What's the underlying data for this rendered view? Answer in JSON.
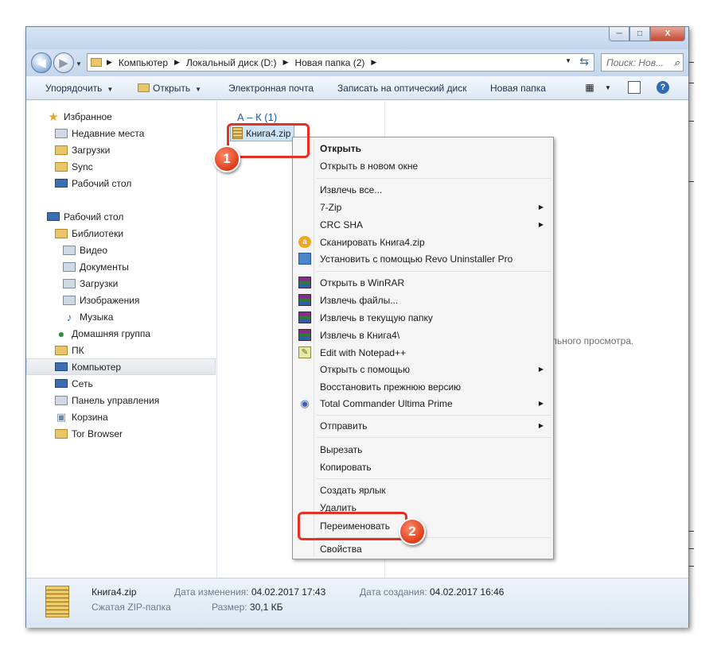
{
  "window": {
    "buttons": {
      "minimize": "─",
      "maximize": "□",
      "close": "X"
    }
  },
  "navigation": {
    "back": "◀",
    "forward": "▶",
    "breadcrumbs": [
      "Компьютер",
      "Локальный диск (D:)",
      "Новая папка (2)"
    ],
    "search_placeholder": "Поиск: Нов..."
  },
  "toolbar": {
    "organize": "Упорядочить",
    "open": "Открыть",
    "email": "Электронная почта",
    "burn": "Записать на оптический диск",
    "new_folder": "Новая папка"
  },
  "sidebar": {
    "items": [
      {
        "label": "Избранное",
        "icon": "star-icon"
      },
      {
        "label": "Недавние места",
        "icon": "recent-places-icon"
      },
      {
        "label": "Загрузки",
        "icon": "downloads-folder-icon"
      },
      {
        "label": "Sync",
        "icon": "folder-icon"
      },
      {
        "label": "Рабочий стол",
        "icon": "desktop-icon"
      },
      {
        "label": "Рабочий стол",
        "icon": "desktop-icon"
      },
      {
        "label": "Библиотеки",
        "icon": "libraries-icon"
      },
      {
        "label": "Видео",
        "icon": "video-library-icon"
      },
      {
        "label": "Документы",
        "icon": "documents-library-icon"
      },
      {
        "label": "Загрузки",
        "icon": "downloads-library-icon"
      },
      {
        "label": "Изображения",
        "icon": "images-library-icon"
      },
      {
        "label": "Музыка",
        "icon": "music-library-icon"
      },
      {
        "label": "Домашняя группа",
        "icon": "homegroup-icon"
      },
      {
        "label": "ПК",
        "icon": "user-folder-icon"
      },
      {
        "label": "Компьютер",
        "icon": "computer-icon"
      },
      {
        "label": "Сеть",
        "icon": "network-icon"
      },
      {
        "label": "Панель управления",
        "icon": "control-panel-icon"
      },
      {
        "label": "Корзина",
        "icon": "recycle-bin-icon"
      },
      {
        "label": "Tor Browser",
        "icon": "folder-icon"
      }
    ],
    "selected": "Компьютер"
  },
  "content": {
    "group_label": "А – К (1)",
    "file_name": "Книга4.zip",
    "preview_text": "льного просмотра."
  },
  "context_menu": {
    "items": [
      {
        "label": "Открыть",
        "bold": true
      },
      {
        "label": "Открыть в новом окне"
      },
      {
        "label": "Извлечь все..."
      },
      {
        "label": "7-Zip",
        "submenu": true
      },
      {
        "label": "CRC SHA",
        "submenu": true
      },
      {
        "label": "Сканировать Книга4.zip",
        "icon": "scan-icon"
      },
      {
        "label": "Установить с помощью Revo Uninstaller Pro",
        "icon": "revo-uninstaller-icon"
      },
      {
        "label": "Открыть в WinRAR",
        "icon": "winrar-icon"
      },
      {
        "label": "Извлечь файлы...",
        "icon": "winrar-icon"
      },
      {
        "label": "Извлечь в текущую папку",
        "icon": "winrar-icon"
      },
      {
        "label": "Извлечь в Книга4\\",
        "icon": "winrar-icon"
      },
      {
        "label": "Edit with Notepad++",
        "icon": "notepad-plus-plus-icon"
      },
      {
        "label": "Открыть с помощью",
        "submenu": true
      },
      {
        "label": "Восстановить прежнюю версию"
      },
      {
        "label": "Total Commander Ultima Prime",
        "icon": "total-commander-icon",
        "submenu": true
      },
      {
        "label": "Отправить",
        "submenu": true
      },
      {
        "label": "Вырезать"
      },
      {
        "label": "Копировать"
      },
      {
        "label": "Создать ярлык"
      },
      {
        "label": "Удалить"
      },
      {
        "label": "Переименовать"
      },
      {
        "label": "Свойства"
      }
    ]
  },
  "status": {
    "file_name": "Книга4.zip",
    "file_type": "Сжатая ZIP-папка",
    "modified_label": "Дата изменения:",
    "modified_value": "04.02.2017 17:43",
    "size_label": "Размер:",
    "size_value": "30,1 КБ",
    "created_label": "Дата создания:",
    "created_value": "04.02.2017 16:46"
  },
  "annotations": {
    "badge1": "1",
    "badge2": "2"
  },
  "colors": {
    "highlight": "#e53124",
    "selection": "#cce4f7",
    "link_blue": "#1e5aa8"
  }
}
